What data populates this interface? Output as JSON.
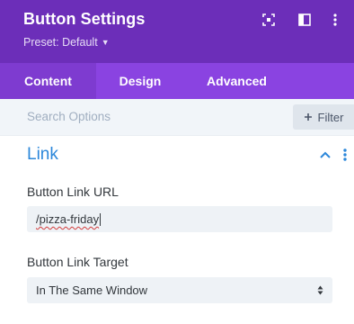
{
  "header": {
    "title": "Button Settings",
    "preset_label": "Preset: Default",
    "icons": [
      "fullscreen-icon",
      "sidebar-toggle-icon",
      "more-vertical-icon"
    ]
  },
  "tabs": [
    {
      "label": "Content",
      "active": true
    },
    {
      "label": "Design",
      "active": false
    },
    {
      "label": "Advanced",
      "active": false
    }
  ],
  "search": {
    "placeholder": "Search Options",
    "filter_label": "Filter"
  },
  "section": {
    "title": "Link",
    "expanded": true
  },
  "fields": {
    "url": {
      "label": "Button Link URL",
      "value": "/pizza-friday"
    },
    "target": {
      "label": "Button Link Target",
      "value": "In The Same Window"
    }
  },
  "colors": {
    "header_bg": "#6c2eb9",
    "tabs_bg": "#8a43e1",
    "active_tab_bg": "#7e3bd0",
    "accent": "#2b87da"
  }
}
